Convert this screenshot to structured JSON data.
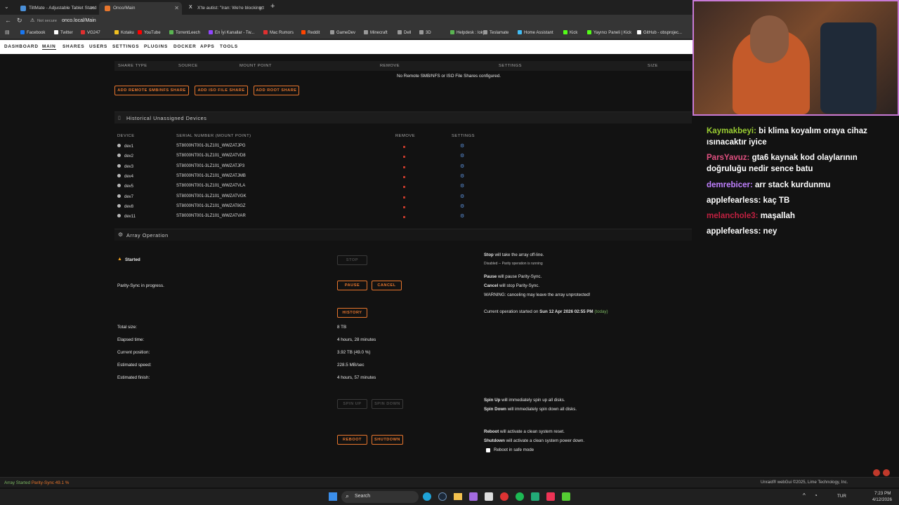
{
  "browser": {
    "tabs": [
      {
        "title": "TiltMate - Adjustable Tablet Stand",
        "color": "#4a90d9"
      },
      {
        "title": "Onco/Main",
        "color": "#e8762d"
      },
      {
        "title": "X'te autist: \"Iran: We're blocking t",
        "color": "#ffffff"
      }
    ],
    "new_tab": "+",
    "secure_label": "Not secure",
    "url": "onco.local/Main",
    "bookmarks": [
      {
        "label": "Facebook",
        "color": "#1877f2"
      },
      {
        "label": "Twitter",
        "color": "#ffffff"
      },
      {
        "label": "VG247",
        "color": "#e03030"
      },
      {
        "label": "Kotaku",
        "color": "#f0c020"
      },
      {
        "label": "YouTube",
        "color": "#ff0000"
      },
      {
        "label": "TorrentLeech",
        "color": "#5ab552"
      },
      {
        "label": "En İyi Kanallar - Tw...",
        "color": "#9146ff"
      },
      {
        "label": "Mac Rumors",
        "color": "#e03030"
      },
      {
        "label": "Reddit",
        "color": "#ff4500"
      },
      {
        "label": "GameDev",
        "color": "#999999"
      },
      {
        "label": "Minecraft",
        "color": "#999999"
      },
      {
        "label": "Dell",
        "color": "#999999"
      },
      {
        "label": "3D",
        "color": "#999999"
      },
      {
        "label": "Helpdesk : loky",
        "color": "#5ab552"
      },
      {
        "label": "Teslamate",
        "color": "#999999"
      },
      {
        "label": "Home Assistant",
        "color": "#41bdf5"
      },
      {
        "label": "Kick",
        "color": "#53fc18"
      },
      {
        "label": "Yayıncı Paneli | Kick",
        "color": "#53fc18"
      },
      {
        "label": "GitHub - obsprojec...",
        "color": "#ffffff"
      }
    ]
  },
  "nav": {
    "items": [
      "DASHBOARD",
      "MAIN",
      "SHARES",
      "USERS",
      "SETTINGS",
      "PLUGINS",
      "DOCKER",
      "APPS",
      "TOOLS"
    ],
    "current": "MAIN"
  },
  "remote_shares": {
    "headers": [
      "SHARE TYPE",
      "SOURCE",
      "MOUNT POINT",
      "REMOVE",
      "SETTINGS",
      "SIZE"
    ],
    "empty": "No Remote SMB/NFS or ISO File Shares configured.",
    "buttons": [
      "ADD REMOTE SMB/NFS SHARE",
      "ADD ISO FILE SHARE",
      "ADD ROOT SHARE"
    ]
  },
  "historical": {
    "title": "Historical Unassigned Devices",
    "headers": [
      "DEVICE",
      "SERIAL NUMBER (MOUNT POINT)",
      "REMOVE",
      "SETTINGS"
    ],
    "devices": [
      {
        "name": "dev1",
        "serial": "ST8000NT001-3LZ101_WWZATJPG"
      },
      {
        "name": "dev2",
        "serial": "ST8000NT001-3LZ101_WWZATVD8"
      },
      {
        "name": "dev3",
        "serial": "ST8000NT001-3LZ101_WWZATJP3"
      },
      {
        "name": "dev4",
        "serial": "ST8000NT001-3LZ101_WWZATJMB"
      },
      {
        "name": "dev5",
        "serial": "ST8000NT001-3LZ101_WWZATVLA"
      },
      {
        "name": "dev7",
        "serial": "ST8000NT001-3LZ101_WWZATVGK"
      },
      {
        "name": "dev8",
        "serial": "ST8000NT001-3LZ101_WWZAT8GZ"
      },
      {
        "name": "dev11",
        "serial": "ST8000NT001-3LZ101_WWZATVAR"
      }
    ]
  },
  "array": {
    "title": "Array Operation",
    "state": "Started",
    "stop_label": "STOP",
    "stop_note_bold": "Stop",
    "stop_note": " will take the array off-line.",
    "disabled_note": "Disabled -- Parity operation is running",
    "parity_status": "Parity-Sync in progress.",
    "pause_label": "PAUSE",
    "cancel_label": "CANCEL",
    "pause_note_bold": "Pause",
    "pause_note": " will pause Parity-Sync.",
    "cancel_note_bold": "Cancel",
    "cancel_note": " will stop Parity-Sync.",
    "warning": "WARNING: canceling may leave the array unprotected!",
    "history_label": "HISTORY",
    "started_prefix": "Current operation started on ",
    "started_date": "Sun 12 Apr 2026 02:55 PM",
    "started_today": "(today)",
    "stats": [
      {
        "label": "Total size:",
        "value": "8 TB"
      },
      {
        "label": "Elapsed time:",
        "value": "4 hours, 28 minutes"
      },
      {
        "label": "Current position:",
        "value": "3.92 TB (49.0 %)"
      },
      {
        "label": "Estimated speed:",
        "value": "228.5 MB/sec"
      },
      {
        "label": "Estimated finish:",
        "value": "4 hours, 57 minutes"
      }
    ],
    "spinup_label": "SPIN UP",
    "spindown_label": "SPIN DOWN",
    "spinup_note_bold": "Spin Up",
    "spinup_note": " will immediately spin up all disks.",
    "spindown_note_bold": "Spin Down",
    "spindown_note": " will immediately spin down all disks.",
    "reboot_label": "REBOOT",
    "shutdown_label": "SHUTDOWN",
    "reboot_note_bold": "Reboot",
    "reboot_note": " will activate a clean system reset.",
    "shutdown_note_bold": "Shutdown",
    "shutdown_note": " will activate a clean system power down.",
    "safe_mode": "Reboot in safe mode"
  },
  "status": {
    "array": "Array Started",
    "parity": "Parity-Sync 49.1 %",
    "footer": "Unraid® webGui ©2025, Lime Technology, Inc."
  },
  "taskbar": {
    "search": "Search",
    "lang": "TUR",
    "time": "7:23 PM",
    "date": "4/12/2026"
  },
  "chat": [
    {
      "user": "Kaymakbeyi:",
      "msg": " bi klima koyalım oraya cihaz ısınacaktır iyice",
      "color": "#9acd32"
    },
    {
      "user": "ParsYavuz:",
      "msg": " gta6 kaynak kod olaylarının doğruluğu nedir sence batu",
      "color": "#e05080"
    },
    {
      "user": "demrebicer:",
      "msg": " arr stack kurdunmu",
      "color": "#c080ff"
    },
    {
      "user": "applefearless:",
      "msg": " kaç TB",
      "color": "#ffffff"
    },
    {
      "user": "melanchole3:",
      "msg": " maşallah",
      "color": "#c02040"
    },
    {
      "user": "applefearless:",
      "msg": " ney",
      "color": "#ffffff"
    }
  ]
}
